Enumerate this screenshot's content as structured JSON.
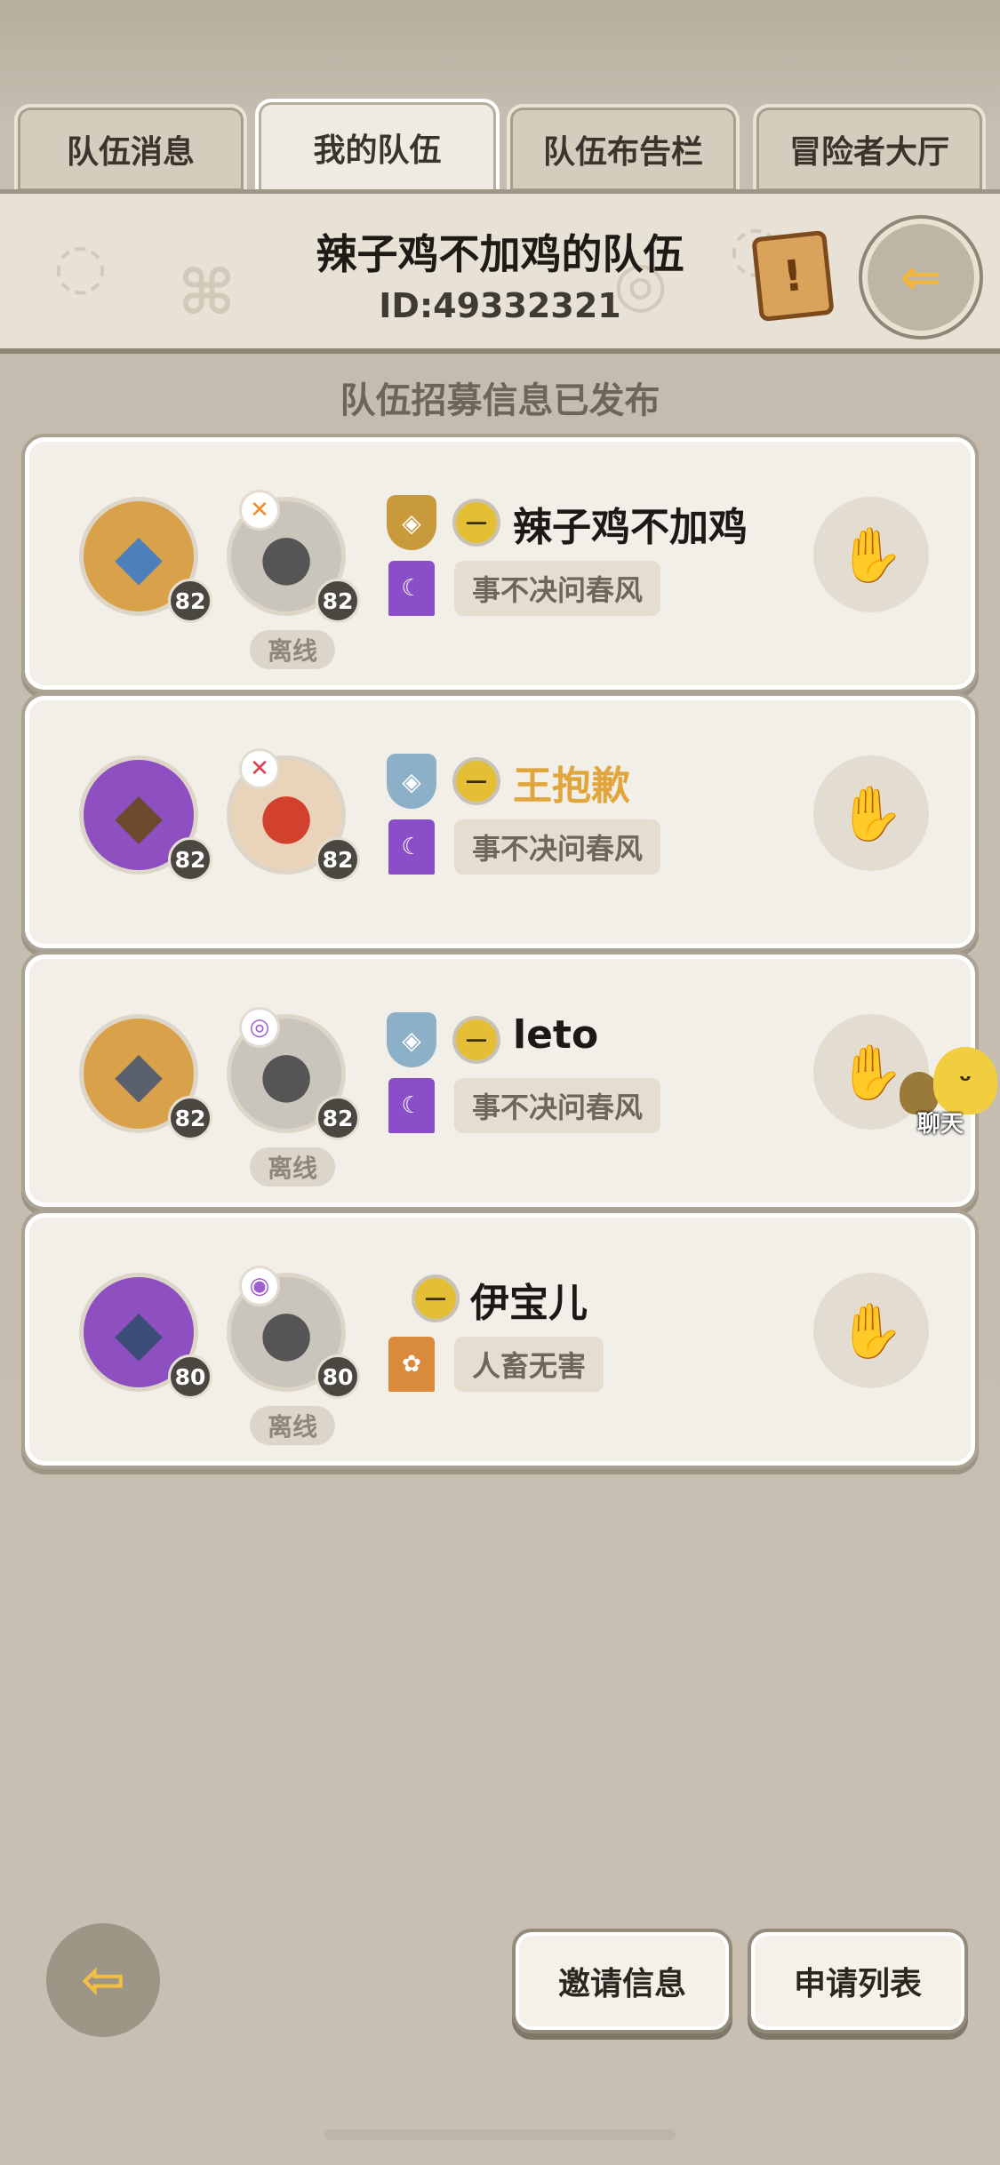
{
  "tabs": [
    {
      "label": "队伍消息",
      "active": false
    },
    {
      "label": "我的队伍",
      "active": true
    },
    {
      "label": "队伍布告栏",
      "active": false
    },
    {
      "label": "冒险者大厅",
      "active": false
    }
  ],
  "header": {
    "team_name": "辣子鸡不加鸡的队伍",
    "team_id": "ID:49332321"
  },
  "recruit_status": "队伍招募信息已发布",
  "members": [
    {
      "pet_level": "82",
      "char_level": "82",
      "status": "离线",
      "name": "辣子鸡不加鸡",
      "guild": "事不决问春风"
    },
    {
      "pet_level": "82",
      "char_level": "82",
      "status": "",
      "name": "王抱歉",
      "guild": "事不决问春风"
    },
    {
      "pet_level": "82",
      "char_level": "82",
      "status": "离线",
      "name": "leto",
      "guild": "事不决问春风"
    },
    {
      "pet_level": "80",
      "char_level": "80",
      "status": "离线",
      "name": "伊宝儿",
      "guild": "人畜无害"
    }
  ],
  "chat_float_label": "聊天",
  "buttons": {
    "invite": "邀请信息",
    "apply_list": "申请列表"
  },
  "colors": {
    "highlight_name": "#e0a63c",
    "guild_purple": "#8a4fc8",
    "guild_orange": "#d98a3a"
  }
}
